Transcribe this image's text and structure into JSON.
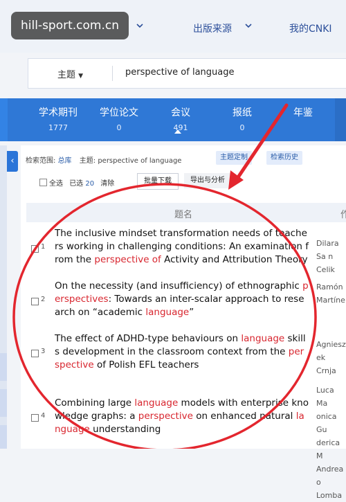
{
  "watermark": {
    "text": "hill-sport.com.cn"
  },
  "top_nav": {
    "publisher_source": "出版来源",
    "my_cnki": "我的CNKI"
  },
  "search": {
    "scope_label": "主题",
    "query": "perspective of language"
  },
  "tabs": [
    {
      "label": "学术期刊",
      "count": "1777"
    },
    {
      "label": "学位论文",
      "count": "0"
    },
    {
      "label": "会议",
      "count": "491"
    },
    {
      "label": "报纸",
      "count": "0"
    },
    {
      "label": "年鉴",
      "count": ""
    }
  ],
  "filters": {
    "scope_prefix": "检索范围:",
    "scope_value": "总库",
    "topic_prefix": "主题:",
    "topic_value": "perspective of language",
    "chip_topic": "主题定制",
    "chip_history": "检索历史"
  },
  "toolbar": {
    "select_all": "全选",
    "selected_prefix": "已选",
    "selected_count": "20",
    "clear": "清除",
    "batch_download": "批量下载",
    "export": "导出与分析"
  },
  "table": {
    "col_title": "题名",
    "col_author": "作",
    "rows": [
      {
        "num": "1",
        "title": [
          {
            "t": "The inclusive mindset transformation needs of teachers working in challenging conditions: An examination from the ",
            "hl": false
          },
          {
            "t": "perspective of",
            "hl": true
          },
          {
            "t": " Activity and Attribution Theory",
            "hl": false
          }
        ],
        "authors": "Dilara Sa n Celik"
      },
      {
        "num": "2",
        "title": [
          {
            "t": "On the necessity (and insufficiency) of ethnographic ",
            "hl": false
          },
          {
            "t": "perspectives",
            "hl": true
          },
          {
            "t": ": Towards an inter-scalar approach to research on “academic ",
            "hl": false
          },
          {
            "t": "language",
            "hl": true
          },
          {
            "t": "”",
            "hl": false
          }
        ],
        "authors": "Ramón Martíne"
      },
      {
        "num": "3",
        "title": [
          {
            "t": "The effect of ADHD-type behaviours on ",
            "hl": false
          },
          {
            "t": "language",
            "hl": true
          },
          {
            "t": " skills development in the classroom context from the ",
            "hl": false
          },
          {
            "t": "perspective",
            "hl": true
          },
          {
            "t": " of Polish EFL teachers",
            "hl": false
          }
        ],
        "authors": "Agniesz ek Crnja"
      },
      {
        "num": "4",
        "title": [
          {
            "t": "Combining large ",
            "hl": false
          },
          {
            "t": "language",
            "hl": true
          },
          {
            "t": " models with enterprise knowledge graphs: a ",
            "hl": false
          },
          {
            "t": "perspective",
            "hl": true
          },
          {
            "t": " on enhanced natural ",
            "hl": false
          },
          {
            "t": "language",
            "hl": true
          },
          {
            "t": " understanding",
            "hl": false
          }
        ],
        "authors": "Luca Ma onica Gu derica M Andrea o Lomba"
      }
    ]
  },
  "colors": {
    "nav_blue": "#2f78d6",
    "highlight_red": "#d8262f",
    "annotation_red": "#e3262e"
  }
}
